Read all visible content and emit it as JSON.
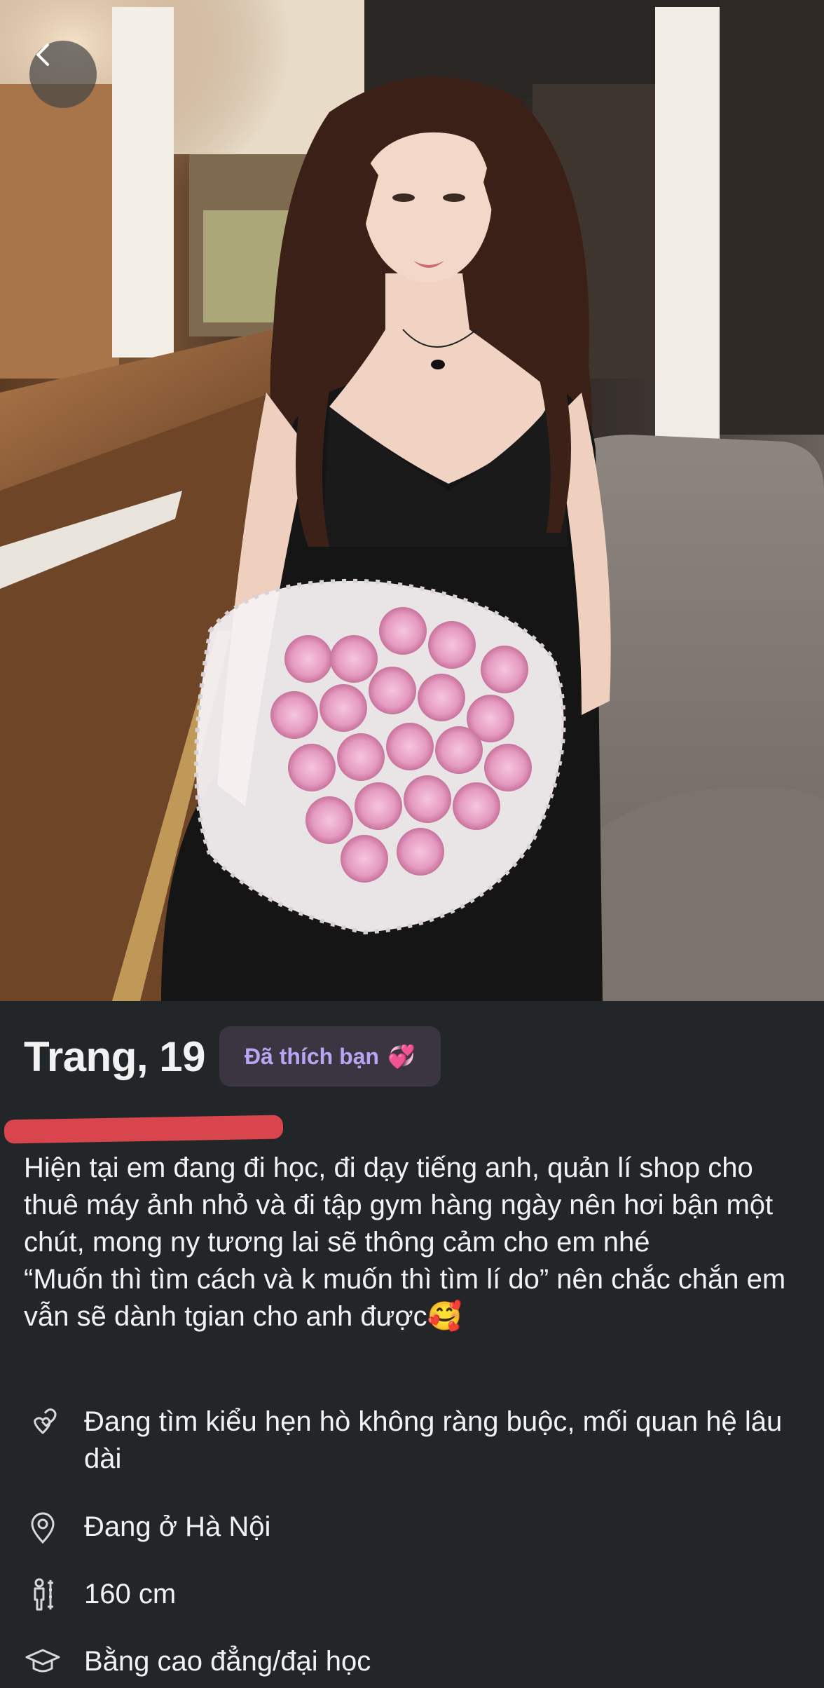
{
  "profile": {
    "name_age": "Trang, 19",
    "liked_badge": "Đã thích bạn",
    "liked_emoji": "💞",
    "bio": "Hiện tại em đang đi học, đi dạy tiếng anh, quản lí shop cho thuê máy ảnh nhỏ và đi tập gym hàng ngày nên hơi bận một chút, mong ny tương lai sẽ thông cảm cho em nhé\n“Muốn thì tìm cách và k muốn thì tìm lí do” nên chắc chắn em vẫn sẽ dành tgian cho anh được🥰",
    "attributes": [
      {
        "icon": "hearts-icon",
        "text": "Đang tìm kiểu hẹn hò không ràng buộc, mối quan hệ lâu dài"
      },
      {
        "icon": "location-pin-icon",
        "text": "Đang ở Hà Nội"
      },
      {
        "icon": "height-icon",
        "text": "160 cm"
      },
      {
        "icon": "graduation-cap-icon",
        "text": "Bằng cao đẳng/đại học"
      }
    ]
  },
  "colors": {
    "background": "#232629",
    "badge_bg": "#3a3541",
    "badge_text": "#b8a6f3",
    "redaction": "#d9454d"
  },
  "icons": {
    "back": "chevron-left-icon"
  }
}
